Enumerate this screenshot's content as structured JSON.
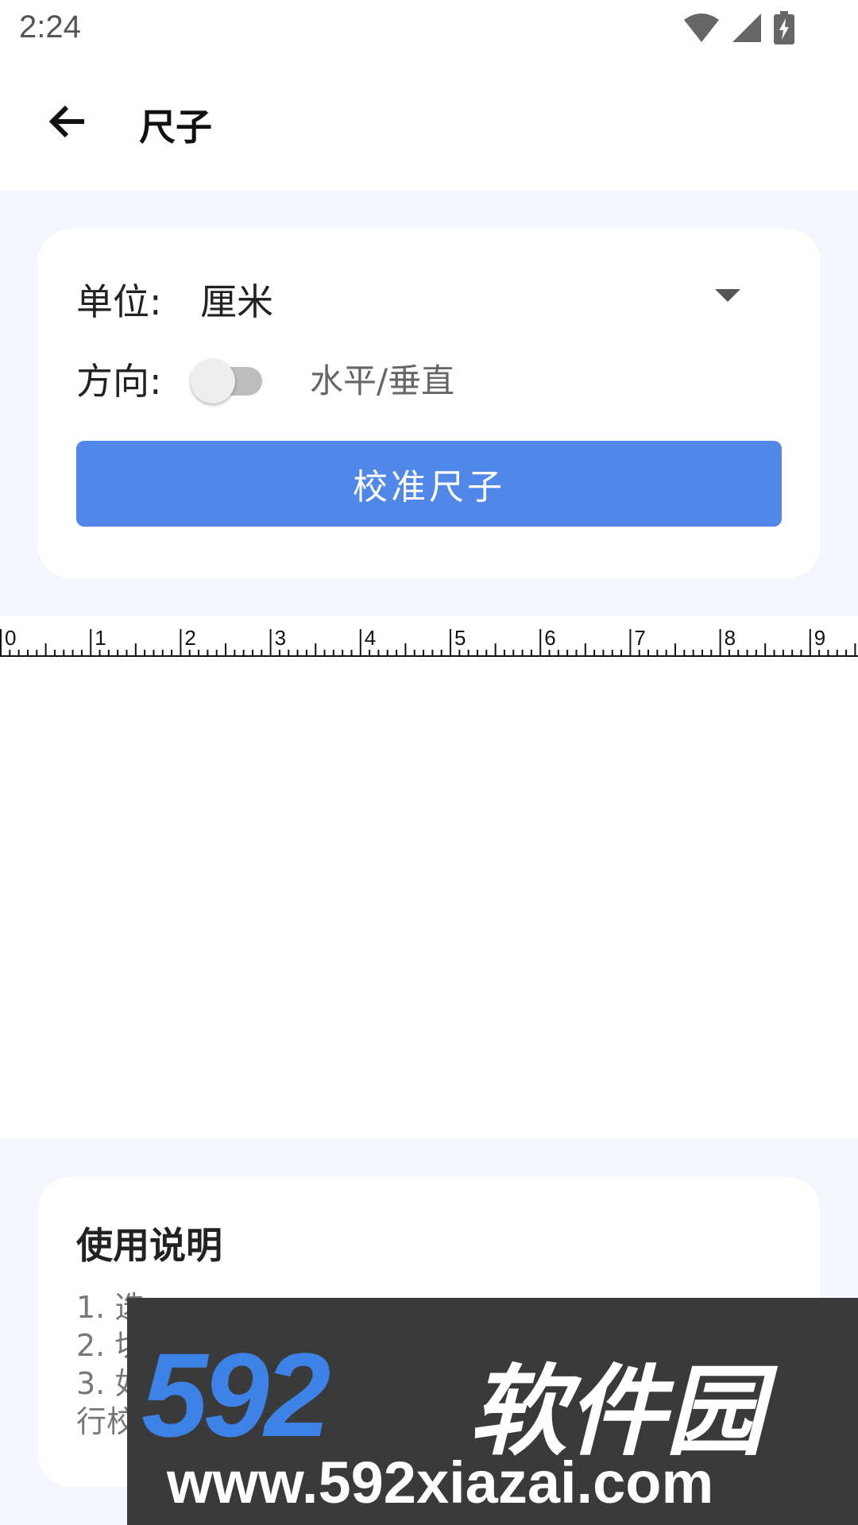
{
  "status_bar": {
    "time": "2:24",
    "icons": [
      "wifi-icon",
      "cellular-signal-icon",
      "battery-charging-icon"
    ]
  },
  "app_bar": {
    "back_icon": "arrow-left-icon",
    "title": "尺子"
  },
  "settings": {
    "unit_label": "单位:",
    "unit_value": "厘米",
    "direction_label": "方向:",
    "direction_toggle_on": false,
    "direction_hint": "水平/垂直",
    "calibrate_button": "校准尺子"
  },
  "ruler": {
    "labels": [
      "0",
      "1",
      "2",
      "3",
      "4",
      "5",
      "6",
      "7",
      "8",
      "9"
    ]
  },
  "help": {
    "title": "使用说明",
    "lines": [
      "1. 选",
      "2. 切",
      "3. 如",
      "行校"
    ]
  },
  "watermark": {
    "brand_number": "592",
    "brand_name": "软件园",
    "url": "www.592xiazai.com"
  },
  "colors": {
    "accent": "#5087e8",
    "page_bg": "#f3f6fd",
    "watermark_blue": "#3d82e6"
  }
}
